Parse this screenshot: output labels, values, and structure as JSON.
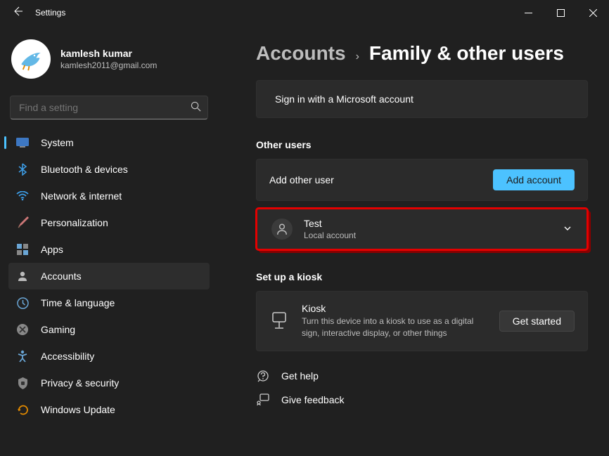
{
  "titlebar": {
    "title": "Settings"
  },
  "profile": {
    "name": "kamlesh kumar",
    "email": "kamlesh2011@gmail.com"
  },
  "search": {
    "placeholder": "Find a setting"
  },
  "nav": {
    "items": [
      {
        "label": "System"
      },
      {
        "label": "Bluetooth & devices"
      },
      {
        "label": "Network & internet"
      },
      {
        "label": "Personalization"
      },
      {
        "label": "Apps"
      },
      {
        "label": "Accounts"
      },
      {
        "label": "Time & language"
      },
      {
        "label": "Gaming"
      },
      {
        "label": "Accessibility"
      },
      {
        "label": "Privacy & security"
      },
      {
        "label": "Windows Update"
      }
    ],
    "selected_index": 5
  },
  "breadcrumb": {
    "parent": "Accounts",
    "current": "Family & other users"
  },
  "sign_in_prompt": "Sign in with a Microsoft account",
  "other_users": {
    "heading": "Other users",
    "add_label": "Add other user",
    "add_button": "Add account",
    "user": {
      "name": "Test",
      "subtitle": "Local account"
    }
  },
  "kiosk": {
    "heading": "Set up a kiosk",
    "title": "Kiosk",
    "desc": "Turn this device into a kiosk to use as a digital sign, interactive display, or other things",
    "button": "Get started"
  },
  "footer": {
    "help": "Get help",
    "feedback": "Give feedback"
  }
}
